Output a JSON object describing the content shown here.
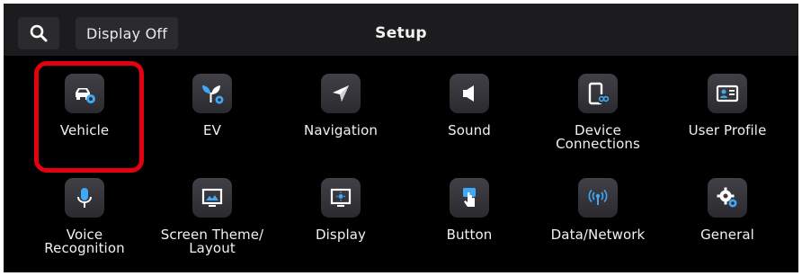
{
  "header": {
    "search_icon": "search-icon",
    "display_off_label": "Display Off",
    "title": "Setup"
  },
  "menu": [
    {
      "label": "Vehicle",
      "icon": "car-gear-icon",
      "highlighted": true
    },
    {
      "label": "EV",
      "icon": "leaf-gear-icon"
    },
    {
      "label": "Navigation",
      "icon": "compass-arrow-icon"
    },
    {
      "label": "Sound",
      "icon": "speaker-icon"
    },
    {
      "label": "Device\nConnections",
      "icon": "phone-connect-icon"
    },
    {
      "label": "User Profile",
      "icon": "id-card-icon"
    },
    {
      "label": "Voice\nRecognition",
      "icon": "microphone-icon"
    },
    {
      "label": "Screen Theme/\nLayout",
      "icon": "picture-monitor-icon"
    },
    {
      "label": "Display",
      "icon": "monitor-brightness-icon"
    },
    {
      "label": "Button",
      "icon": "finger-press-icon"
    },
    {
      "label": "Data/Network",
      "icon": "antenna-signal-icon"
    },
    {
      "label": "General",
      "icon": "gears-icon"
    }
  ],
  "colors": {
    "icon_accent": "#3fa9f5",
    "highlight": "#e3000f"
  }
}
